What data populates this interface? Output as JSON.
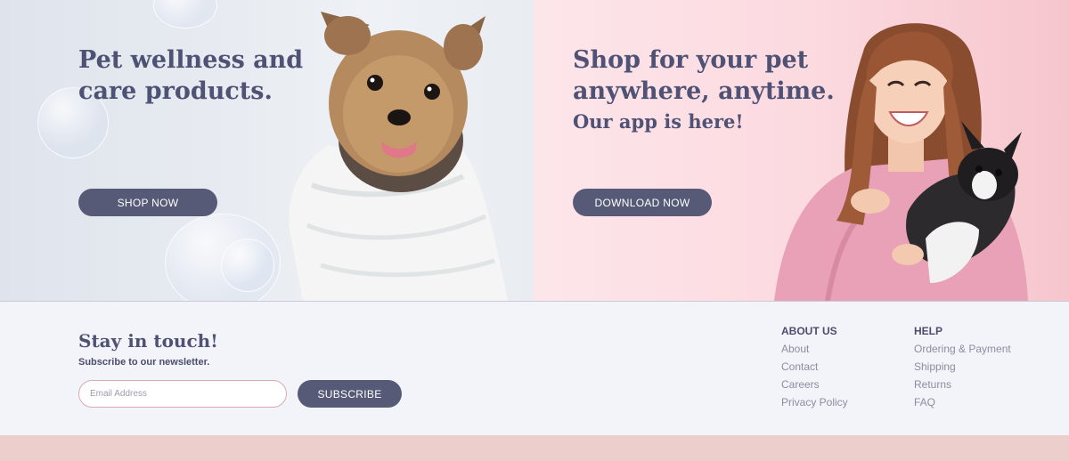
{
  "hero": {
    "left": {
      "headline": "Pet wellness and care products.",
      "button_label": "SHOP NOW"
    },
    "right": {
      "headline": "Shop for your pet anywhere, anytime.",
      "subheadline": "Our app is here!",
      "button_label": "DOWNLOAD NOW"
    }
  },
  "newsletter": {
    "title": "Stay in touch!",
    "subtitle": "Subscribe to our newsletter.",
    "email_placeholder": "Email Address",
    "button_label": "SUBSCRIBE"
  },
  "footer_links": {
    "about": {
      "title": "ABOUT US",
      "links": [
        "About",
        "Contact",
        "Careers",
        "Privacy Policy"
      ]
    },
    "help": {
      "title": "HELP",
      "links": [
        "Ordering & Payment",
        "Shipping",
        "Returns",
        "FAQ"
      ]
    }
  },
  "colors": {
    "button": "#575a76",
    "heading": "#4f5275",
    "left_panel": "#e7ebf1",
    "right_panel": "#fbd9df",
    "bottom_band": "#eccfcd"
  },
  "images": {
    "left": "yorkie-dog-in-towel-photo",
    "right": "smiling-woman-holding-french-bulldog-photo"
  }
}
